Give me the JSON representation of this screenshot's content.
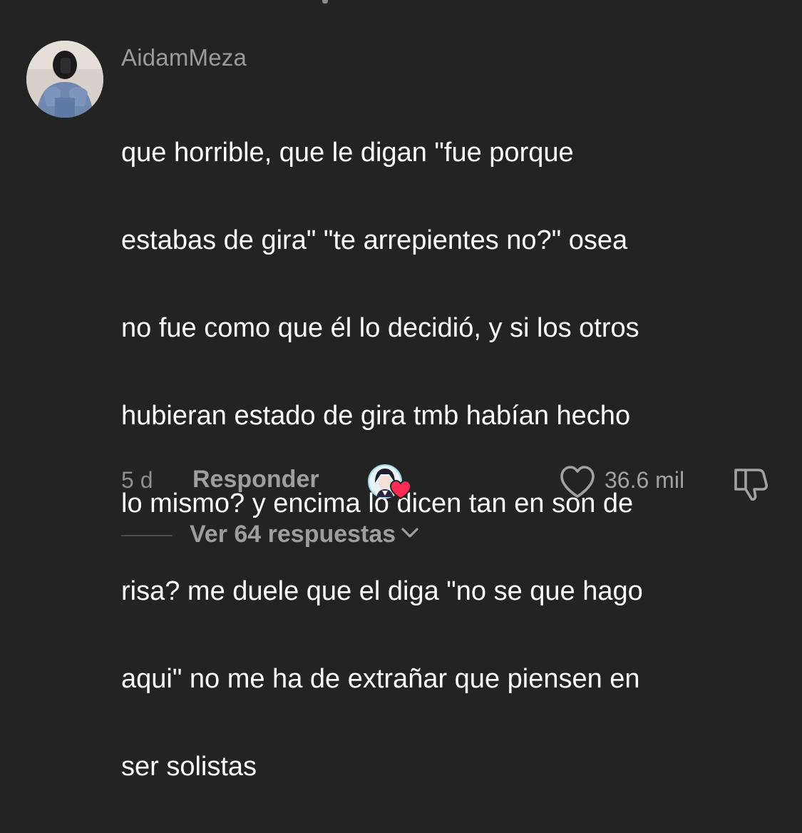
{
  "comment": {
    "username": "AidamMeza",
    "text_lines": [
      "que horrible, que le digan \"fue porque",
      "estabas de gira\" \"te arrepientes no?\" osea",
      "no fue como que él lo decidió, y si los otros",
      "hubieran estado de gira tmb habían hecho",
      "lo mismo? y encima lo dicen tan en son de",
      "risa? me duele que el diga \"no se que hago",
      "aqui\" no me ha de extrañar que piensen en",
      "ser solistas"
    ],
    "time": "5 d",
    "reply_label": "Responder",
    "like_count": "36.6 mil",
    "view_replies_label": "Ver 64 respuestas"
  },
  "icons": {
    "like": "heart-outline-icon",
    "dislike": "thumbs-down-icon",
    "creator_like": "creator-liked-heart-icon",
    "expand": "chevron-down-icon"
  },
  "colors": {
    "background": "#232323",
    "text_primary": "#ffffff",
    "text_secondary": "#9e9e9e",
    "creator_heart": "#ff2d55"
  }
}
